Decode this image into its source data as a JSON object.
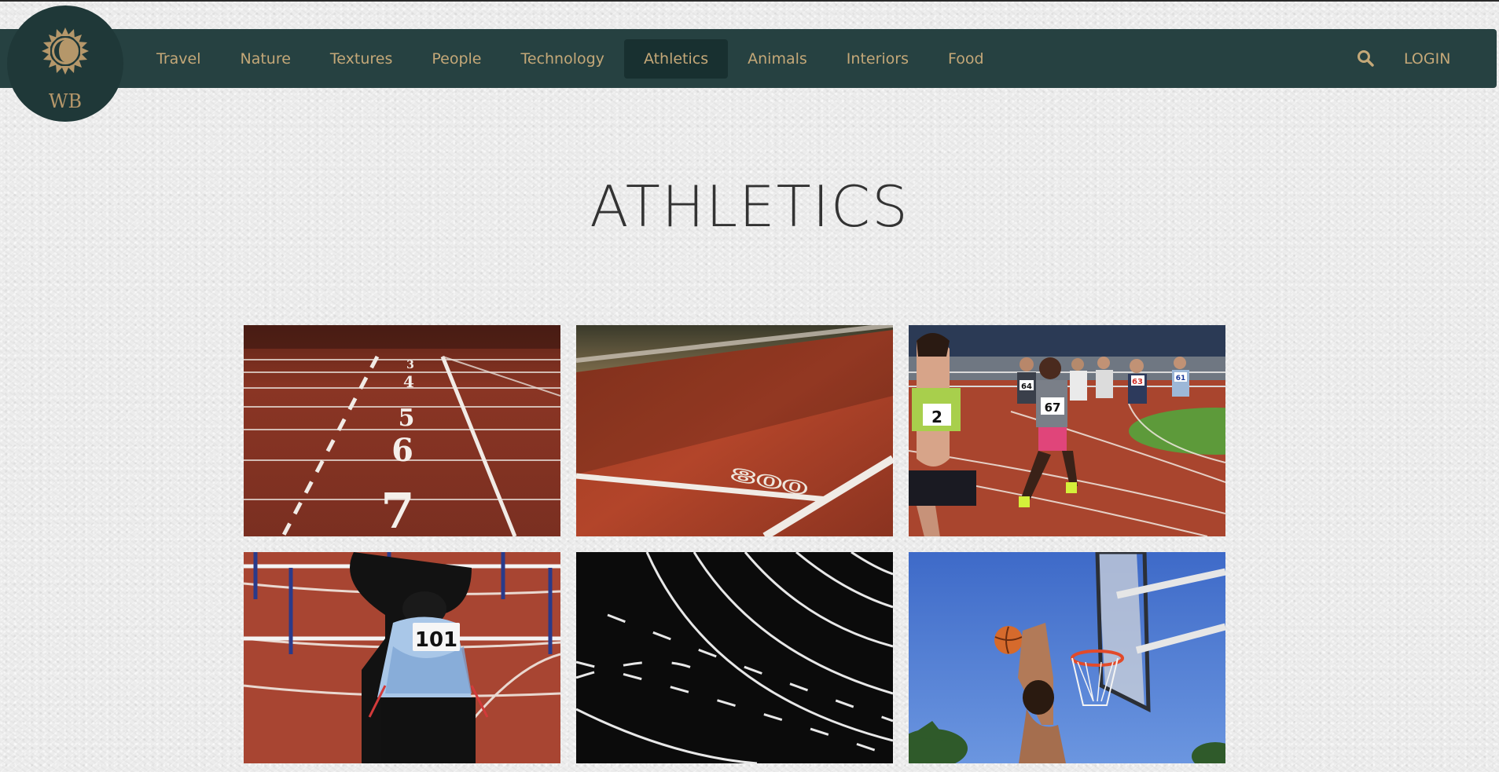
{
  "logo": {
    "text": "WB",
    "icon": "sun-moon-icon"
  },
  "nav": {
    "items": [
      {
        "label": "Travel"
      },
      {
        "label": "Nature"
      },
      {
        "label": "Textures"
      },
      {
        "label": "People"
      },
      {
        "label": "Technology"
      },
      {
        "label": "Athletics",
        "active": true
      },
      {
        "label": "Animals"
      },
      {
        "label": "Interiors"
      },
      {
        "label": "Food"
      }
    ],
    "search_icon": "search-icon",
    "login_label": "LOGIN"
  },
  "page": {
    "title": "ATHLETICS"
  },
  "gallery": {
    "images": [
      {
        "subject": "track-lanes-numbers",
        "lane_numbers": [
          "3",
          "4",
          "5",
          "6",
          "7"
        ]
      },
      {
        "subject": "track-800-marking",
        "marking": "800"
      },
      {
        "subject": "women-running-race",
        "bibs": [
          "2",
          "67",
          "64",
          "63",
          "61"
        ]
      },
      {
        "subject": "hurdler-at-start",
        "bib": "101"
      },
      {
        "subject": "black-track-lines"
      },
      {
        "subject": "basketball-dunk"
      }
    ]
  },
  "colors": {
    "navbar": "#264141",
    "nav_text": "#c4a878",
    "nav_active": "#183030",
    "background": "#ececec"
  }
}
